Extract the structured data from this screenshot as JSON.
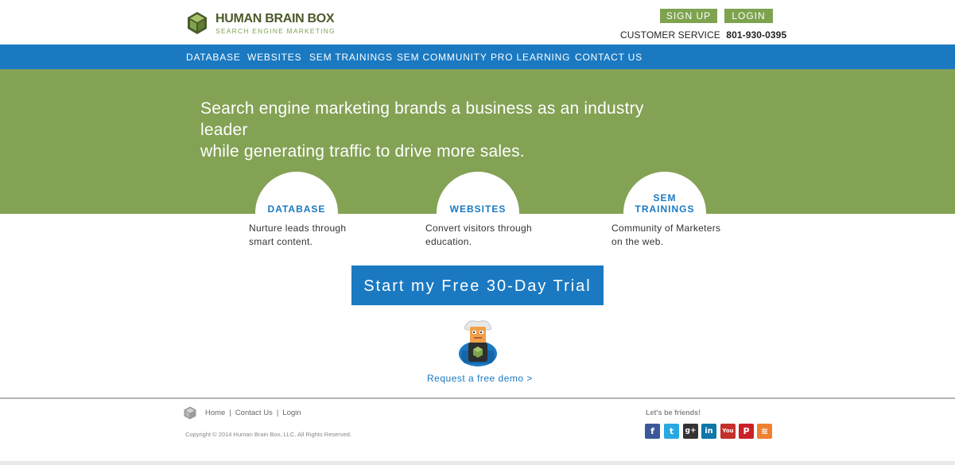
{
  "header": {
    "logo_title": "HUMAN BRAIN BOX",
    "logo_subtitle": "SEARCH ENGINE MARKETING",
    "signup_label": "SIGN UP",
    "login_label": "LOGIN",
    "customer_service_label": "CUSTOMER SERVICE",
    "customer_service_phone": "801-930-0395"
  },
  "nav": {
    "items": [
      "DATABASE",
      "WEBSITES",
      "SEM TRAININGS",
      "SEM COMMUNITY",
      "PRO LEARNING",
      "CONTACT US"
    ]
  },
  "hero": {
    "line1": "Search engine marketing brands a business as an industry leader",
    "line2": "while generating traffic to drive more sales."
  },
  "features": [
    {
      "title": "DATABASE",
      "desc1": "Nurture leads through",
      "desc2": "smart content."
    },
    {
      "title": "WEBSITES",
      "desc1": "Convert visitors through",
      "desc2": "education."
    },
    {
      "title_line1": "SEM",
      "title_line2": "TRAININGS",
      "desc1": "Community of Marketers",
      "desc2": "on the web."
    }
  ],
  "cta": {
    "label": "Start my Free 30-Day Trial"
  },
  "demo": {
    "label": "Request a free demo >"
  },
  "footer": {
    "links": [
      "Home",
      "Contact Us",
      "Login"
    ],
    "separator": "|",
    "copyright": "Copyright © 2014 Human Brain Box, LLC. All Rights Reserved.",
    "friends_label": "Let's be friends!",
    "social": [
      {
        "name": "facebook",
        "glyph": "f",
        "color": "#3b5998"
      },
      {
        "name": "twitter",
        "glyph": "t",
        "color": "#29a9e1"
      },
      {
        "name": "google-plus",
        "glyph": "g+",
        "color": "#333333"
      },
      {
        "name": "linkedin",
        "glyph": "in",
        "color": "#0e76a8"
      },
      {
        "name": "youtube",
        "glyph": "You",
        "color": "#c4302b"
      },
      {
        "name": "pinterest",
        "glyph": "P",
        "color": "#cb2027"
      },
      {
        "name": "rss",
        "glyph": "≋",
        "color": "#ee802f"
      }
    ]
  },
  "colors": {
    "brand_green": "#83a254",
    "brand_blue": "#1a79c1",
    "button_green": "#7ea34f"
  }
}
